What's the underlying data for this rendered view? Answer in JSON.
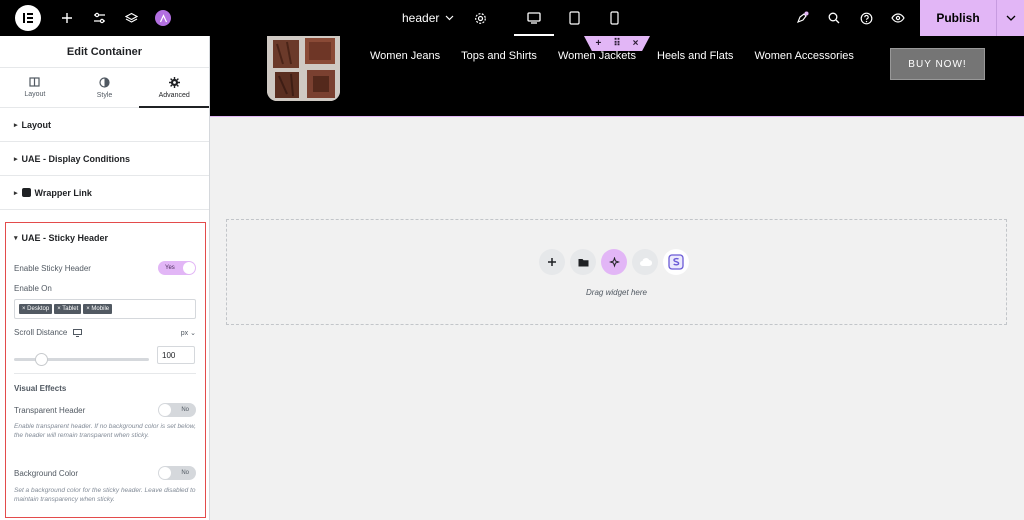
{
  "topbar": {
    "document_title": "header",
    "publish_label": "Publish"
  },
  "panel": {
    "title": "Edit Container",
    "tabs": [
      {
        "label": "Layout"
      },
      {
        "label": "Style"
      },
      {
        "label": "Advanced"
      }
    ],
    "sections": [
      {
        "label": "Layout"
      },
      {
        "label": "UAE - Display Conditions"
      },
      {
        "label": "Wrapper Link"
      }
    ],
    "sticky": {
      "title": "UAE - Sticky Header",
      "enable_label": "Enable Sticky Header",
      "enable_state": "Yes",
      "enable_on_label": "Enable On",
      "chips": [
        "× Desktop",
        "× Tablet",
        "× Mobile"
      ],
      "scroll_label": "Scroll Distance",
      "unit": "px",
      "scroll_value": "100",
      "scroll_fraction": 0.2,
      "visual_effects": "Visual Effects",
      "transparent_label": "Transparent Header",
      "transparent_state": "No",
      "transparent_desc": "Enable transparent header. If no background color is set below, the header will remain transparent when sticky.",
      "bg_label": "Background Color",
      "bg_state": "No",
      "bg_desc": "Set a background color for the sticky header. Leave disabled to maintain transparency when sticky."
    }
  },
  "canvas": {
    "nav_items": [
      "Women Jeans",
      "Tops and Shirts",
      "Women Jackets",
      "Heels and Flats",
      "Women Accessories"
    ],
    "buy_label": "BUY NOW!",
    "drop_label": "Drag widget here"
  },
  "colors": {
    "accent": "#e2b6f6",
    "highlight_border": "#e34b4b"
  }
}
